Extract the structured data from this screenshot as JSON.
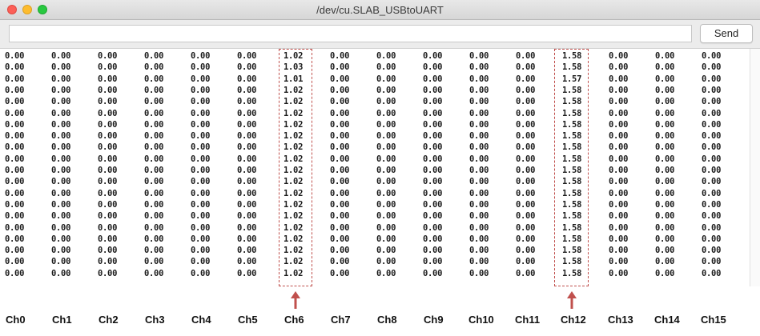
{
  "window": {
    "title": "/dev/cu.SLAB_USBtoUART"
  },
  "toolbar": {
    "input_value": "",
    "send_label": "Send"
  },
  "serial_rows": [
    [
      "0.00",
      "0.00",
      "0.00",
      "0.00",
      "0.00",
      "0.00",
      "1.02",
      "0.00",
      "0.00",
      "0.00",
      "0.00",
      "0.00",
      "1.58",
      "0.00",
      "0.00",
      "0.00"
    ],
    [
      "0.00",
      "0.00",
      "0.00",
      "0.00",
      "0.00",
      "0.00",
      "1.03",
      "0.00",
      "0.00",
      "0.00",
      "0.00",
      "0.00",
      "1.58",
      "0.00",
      "0.00",
      "0.00"
    ],
    [
      "0.00",
      "0.00",
      "0.00",
      "0.00",
      "0.00",
      "0.00",
      "1.01",
      "0.00",
      "0.00",
      "0.00",
      "0.00",
      "0.00",
      "1.57",
      "0.00",
      "0.00",
      "0.00"
    ],
    [
      "0.00",
      "0.00",
      "0.00",
      "0.00",
      "0.00",
      "0.00",
      "1.02",
      "0.00",
      "0.00",
      "0.00",
      "0.00",
      "0.00",
      "1.58",
      "0.00",
      "0.00",
      "0.00"
    ],
    [
      "0.00",
      "0.00",
      "0.00",
      "0.00",
      "0.00",
      "0.00",
      "1.02",
      "0.00",
      "0.00",
      "0.00",
      "0.00",
      "0.00",
      "1.58",
      "0.00",
      "0.00",
      "0.00"
    ],
    [
      "0.00",
      "0.00",
      "0.00",
      "0.00",
      "0.00",
      "0.00",
      "1.02",
      "0.00",
      "0.00",
      "0.00",
      "0.00",
      "0.00",
      "1.58",
      "0.00",
      "0.00",
      "0.00"
    ],
    [
      "0.00",
      "0.00",
      "0.00",
      "0.00",
      "0.00",
      "0.00",
      "1.02",
      "0.00",
      "0.00",
      "0.00",
      "0.00",
      "0.00",
      "1.58",
      "0.00",
      "0.00",
      "0.00"
    ],
    [
      "0.00",
      "0.00",
      "0.00",
      "0.00",
      "0.00",
      "0.00",
      "1.02",
      "0.00",
      "0.00",
      "0.00",
      "0.00",
      "0.00",
      "1.58",
      "0.00",
      "0.00",
      "0.00"
    ],
    [
      "0.00",
      "0.00",
      "0.00",
      "0.00",
      "0.00",
      "0.00",
      "1.02",
      "0.00",
      "0.00",
      "0.00",
      "0.00",
      "0.00",
      "1.58",
      "0.00",
      "0.00",
      "0.00"
    ],
    [
      "0.00",
      "0.00",
      "0.00",
      "0.00",
      "0.00",
      "0.00",
      "1.02",
      "0.00",
      "0.00",
      "0.00",
      "0.00",
      "0.00",
      "1.58",
      "0.00",
      "0.00",
      "0.00"
    ],
    [
      "0.00",
      "0.00",
      "0.00",
      "0.00",
      "0.00",
      "0.00",
      "1.02",
      "0.00",
      "0.00",
      "0.00",
      "0.00",
      "0.00",
      "1.58",
      "0.00",
      "0.00",
      "0.00"
    ],
    [
      "0.00",
      "0.00",
      "0.00",
      "0.00",
      "0.00",
      "0.00",
      "1.02",
      "0.00",
      "0.00",
      "0.00",
      "0.00",
      "0.00",
      "1.58",
      "0.00",
      "0.00",
      "0.00"
    ],
    [
      "0.00",
      "0.00",
      "0.00",
      "0.00",
      "0.00",
      "0.00",
      "1.02",
      "0.00",
      "0.00",
      "0.00",
      "0.00",
      "0.00",
      "1.58",
      "0.00",
      "0.00",
      "0.00"
    ],
    [
      "0.00",
      "0.00",
      "0.00",
      "0.00",
      "0.00",
      "0.00",
      "1.02",
      "0.00",
      "0.00",
      "0.00",
      "0.00",
      "0.00",
      "1.58",
      "0.00",
      "0.00",
      "0.00"
    ],
    [
      "0.00",
      "0.00",
      "0.00",
      "0.00",
      "0.00",
      "0.00",
      "1.02",
      "0.00",
      "0.00",
      "0.00",
      "0.00",
      "0.00",
      "1.58",
      "0.00",
      "0.00",
      "0.00"
    ],
    [
      "0.00",
      "0.00",
      "0.00",
      "0.00",
      "0.00",
      "0.00",
      "1.02",
      "0.00",
      "0.00",
      "0.00",
      "0.00",
      "0.00",
      "1.58",
      "0.00",
      "0.00",
      "0.00"
    ],
    [
      "0.00",
      "0.00",
      "0.00",
      "0.00",
      "0.00",
      "0.00",
      "1.02",
      "0.00",
      "0.00",
      "0.00",
      "0.00",
      "0.00",
      "1.58",
      "0.00",
      "0.00",
      "0.00"
    ],
    [
      "0.00",
      "0.00",
      "0.00",
      "0.00",
      "0.00",
      "0.00",
      "1.02",
      "0.00",
      "0.00",
      "0.00",
      "0.00",
      "0.00",
      "1.58",
      "0.00",
      "0.00",
      "0.00"
    ],
    [
      "0.00",
      "0.00",
      "0.00",
      "0.00",
      "0.00",
      "0.00",
      "1.02",
      "0.00",
      "0.00",
      "0.00",
      "0.00",
      "0.00",
      "1.58",
      "0.00",
      "0.00",
      "0.00"
    ],
    [
      "0.00",
      "0.00",
      "0.00",
      "0.00",
      "0.00",
      "0.00",
      "1.02",
      "0.00",
      "0.00",
      "0.00",
      "0.00",
      "0.00",
      "1.58",
      "0.00",
      "0.00",
      "0.00"
    ]
  ],
  "channel_labels": [
    "Ch0",
    "Ch1",
    "Ch2",
    "Ch3",
    "Ch4",
    "Ch5",
    "Ch6",
    "Ch7",
    "Ch8",
    "Ch9",
    "Ch10",
    "Ch11",
    "Ch12",
    "Ch13",
    "Ch14",
    "Ch15"
  ],
  "highlighted_channels": [
    6,
    12
  ],
  "colors": {
    "highlight": "#c0504d",
    "text": "#1a1a1a"
  }
}
